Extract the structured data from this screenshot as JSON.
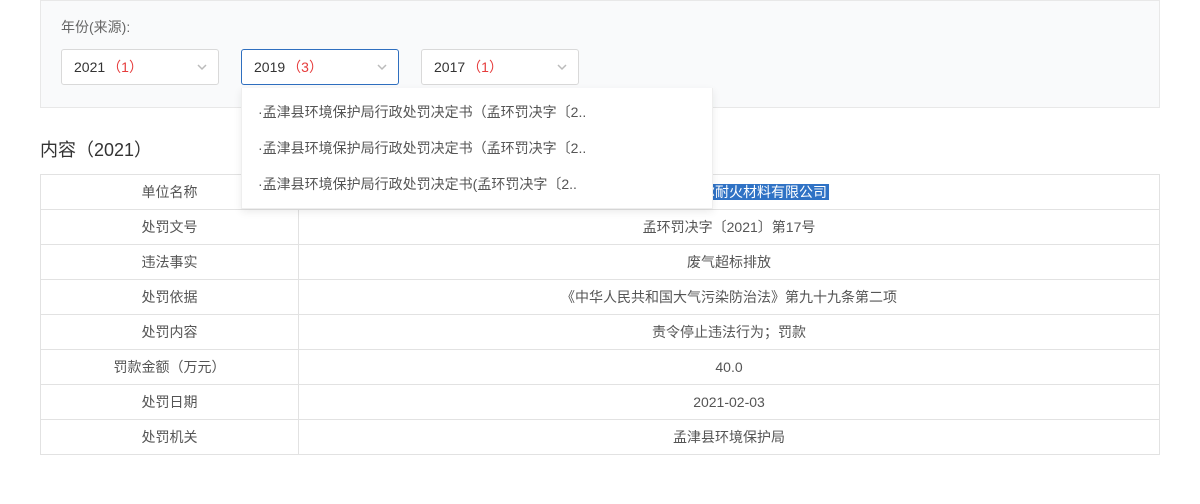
{
  "filter": {
    "label": "年份(来源):",
    "years": [
      {
        "year": "2021",
        "count": "（1）"
      },
      {
        "year": "2019",
        "count": "（3）"
      },
      {
        "year": "2017",
        "count": "（1）"
      }
    ],
    "active_index": 1,
    "menu_items": [
      "·孟津县环境保护局行政处罚决定书（孟环罚决字〔2..",
      "·孟津县环境保护局行政处罚决定书（孟环罚决字〔2..",
      "·孟津县环境保护局行政处罚决定书(孟环罚决字〔2.."
    ]
  },
  "section_title": "内容（2021）",
  "table": {
    "rows": [
      {
        "label": "单位名称",
        "value": "洛阳洛耐菲尔耐火材料有限公司",
        "highlight": true
      },
      {
        "label": "处罚文号",
        "value": "孟环罚决字〔2021〕第17号"
      },
      {
        "label": "违法事实",
        "value": "废气超标排放"
      },
      {
        "label": "处罚依据",
        "value": "《中华人民共和国大气污染防治法》第九十九条第二项"
      },
      {
        "label": "处罚内容",
        "value": "责令停止违法行为；罚款"
      },
      {
        "label": "罚款金额（万元）",
        "value": "40.0"
      },
      {
        "label": "处罚日期",
        "value": "2021-02-03"
      },
      {
        "label": "处罚机关",
        "value": "孟津县环境保护局"
      }
    ]
  }
}
